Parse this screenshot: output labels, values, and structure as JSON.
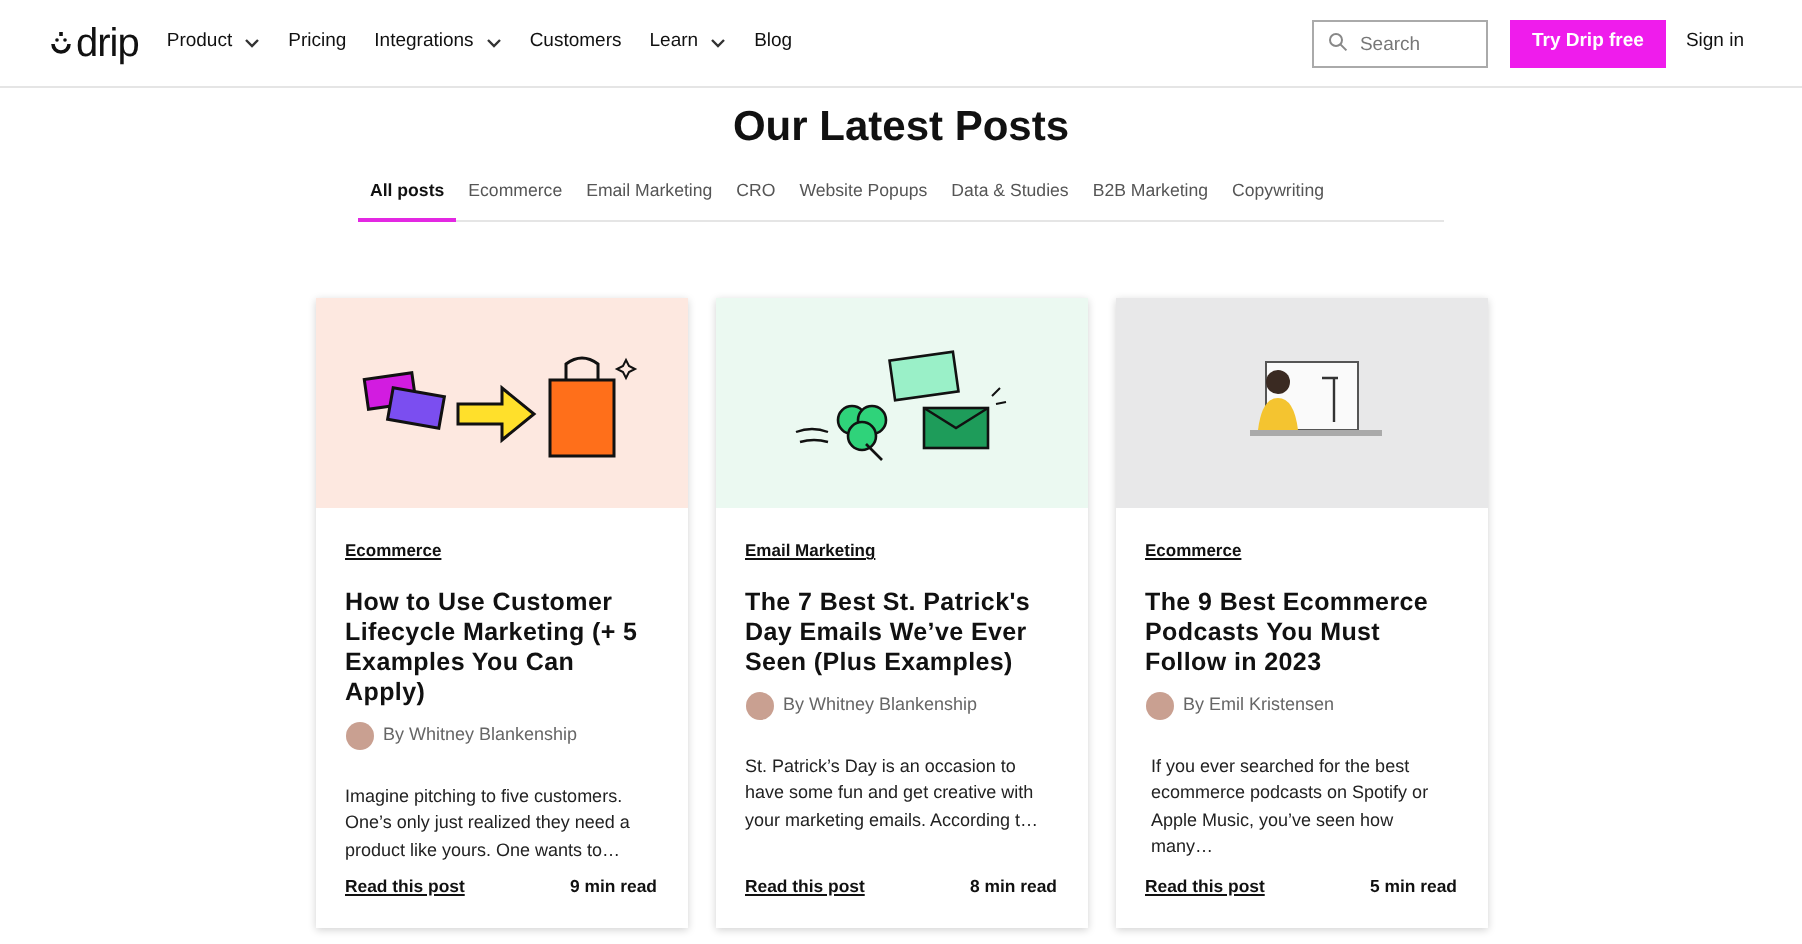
{
  "nav": {
    "logo": "drip",
    "items": [
      {
        "label": "Product",
        "dropdown": true
      },
      {
        "label": "Pricing",
        "dropdown": false
      },
      {
        "label": "Integrations",
        "dropdown": true
      },
      {
        "label": "Customers",
        "dropdown": false
      },
      {
        "label": "Learn",
        "dropdown": true
      },
      {
        "label": "Blog",
        "dropdown": false
      }
    ],
    "search": {
      "placeholder": "Search"
    },
    "cta": "Try Drip free",
    "sign_in": "Sign in"
  },
  "heading": "Our Latest Posts",
  "tabs": [
    {
      "label": "All posts",
      "selected": true
    },
    {
      "label": "Ecommerce",
      "selected": false
    },
    {
      "label": "Email Marketing",
      "selected": false
    },
    {
      "label": "CRO",
      "selected": false
    },
    {
      "label": "Website Popups",
      "selected": false
    },
    {
      "label": "Data & Studies",
      "selected": false
    },
    {
      "label": "B2B Marketing",
      "selected": false
    },
    {
      "label": "Copywriting",
      "selected": false
    }
  ],
  "posts": [
    {
      "kind": "shopping",
      "category": "Ecommerce",
      "title": "How to Use Customer Lifecycle Marketing (+ 5 Examples You Can Apply)",
      "author": "By Whitney Blankenship",
      "excerpt": "Imagine pitching to five customers. One’s only just realized they need a product like yours. One wants to…",
      "link": "Read this post",
      "read_time": "9 min read"
    },
    {
      "kind": "clover",
      "category": "Email Marketing",
      "title": "The 7 Best St. Patrick's Day Emails We’ve Ever Seen (Plus Examples)",
      "author": "By Whitney Blankenship",
      "excerpt": "St. Patrick’s Day is an occasion to have some fun and get creative with your marketing emails.  According t…",
      "link": "Read this post",
      "read_time": "8 min read"
    },
    {
      "kind": "podcast",
      "category": "Ecommerce",
      "title": "The 9 Best Ecommerce Podcasts You Must Follow in 2023",
      "author": "By Emil Kristensen",
      "excerpt": "If you ever searched for the best ecommerce podcasts on Spotify or Apple Music, you’ve seen how many…",
      "link": "Read this post",
      "read_time": "5 min read"
    }
  ]
}
